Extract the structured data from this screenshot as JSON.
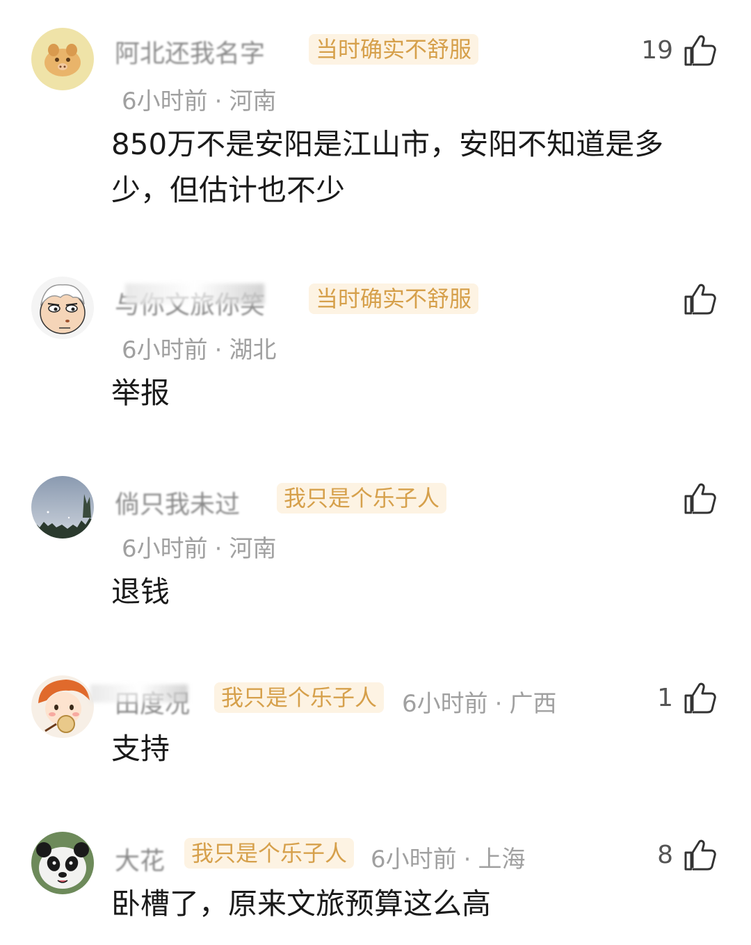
{
  "comments": [
    {
      "username": "阿北还我名字",
      "badge": "当时确实不舒服",
      "time": "6小时前",
      "location": "河南",
      "text": "850万不是安阳是江山市，安阳不知道是多少，但估计也不少",
      "likes": "19",
      "avatar_icon": "cartoon-pig-avatar"
    },
    {
      "username": "与你文旅你笑",
      "badge": "当时确实不舒服",
      "time": "6小时前",
      "location": "湖北",
      "text": "举报",
      "likes": "",
      "avatar_icon": "cartoon-face-avatar"
    },
    {
      "username": "倘只我未过",
      "badge": "我只是个乐子人",
      "time": "6小时前",
      "location": "河南",
      "text": "退钱",
      "likes": "",
      "avatar_icon": "night-sky-avatar"
    },
    {
      "username": "田度况",
      "badge": "我只是个乐子人",
      "time": "6小时前",
      "location": "广西",
      "text": "支持",
      "likes": "1",
      "avatar_icon": "cartoon-girl-avatar"
    },
    {
      "username": "大花",
      "badge": "我只是个乐子人",
      "time": "6小时前",
      "location": "上海",
      "text": "卧槽了，原来文旅预算这么高",
      "likes": "8",
      "avatar_icon": "panda-avatar"
    }
  ],
  "separator": "·",
  "colors": {
    "badge_bg": "#fdf3e3",
    "badge_text": "#d6a04b",
    "meta_text": "#a0a0a0"
  }
}
